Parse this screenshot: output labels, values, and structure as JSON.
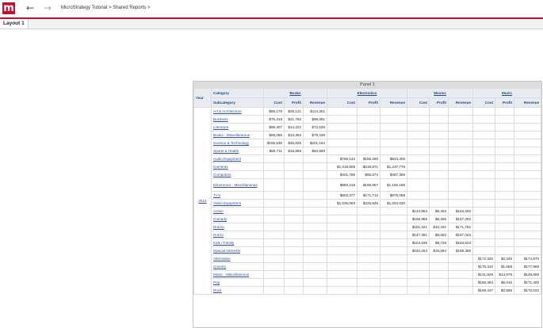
{
  "header": {
    "logo_letter": "m",
    "breadcrumb": [
      "MicroStrategy Tutorial",
      "Shared Reports"
    ],
    "breadcrumb_sep": ">",
    "brand_color": "#c8102e"
  },
  "tabs": [
    "Layout 1"
  ],
  "panel": {
    "title": "Panel 1",
    "year_header": "Year",
    "category_header": "Category",
    "subcategory_header": "Subcategory",
    "categories": [
      "Books",
      "Electronics",
      "Movies",
      "Music"
    ],
    "metrics": [
      "Cost",
      "Profit",
      "Revenue"
    ],
    "year": "2014",
    "rows": [
      {
        "sub": "Art & Architecture",
        "vals": [
          "$88,179",
          "$26,121",
          "$114,301",
          "",
          "",
          "",
          "",
          "",
          "",
          "",
          "",
          ""
        ]
      },
      {
        "sub": "Business",
        "vals": [
          "$76,319",
          "$21,762",
          "$98,081",
          "",
          "",
          "",
          "",
          "",
          "",
          "",
          "",
          ""
        ]
      },
      {
        "sub": "Literature",
        "vals": [
          "$58,407",
          "$14,222",
          "$72,629",
          "",
          "",
          "",
          "",
          "",
          "",
          "",
          "",
          ""
        ]
      },
      {
        "sub": "Books - Miscellaneous",
        "vals": [
          "$66,085",
          "$13,353",
          "$79,438",
          "",
          "",
          "",
          "",
          "",
          "",
          "",
          "",
          ""
        ]
      },
      {
        "sub": "Science & Technology",
        "vals": [
          "$155,538",
          "$45,625",
          "$201,164",
          "",
          "",
          "",
          "",
          "",
          "",
          "",
          "",
          ""
        ]
      },
      {
        "sub": "Sports & Health",
        "vals": [
          "$65,711",
          "$18,869",
          "$84,580",
          "",
          "",
          "",
          "",
          "",
          "",
          "",
          "",
          ""
        ]
      },
      {
        "sub": "Audio Equipment",
        "vals": [
          "",
          "",
          "",
          "$768,144",
          "$155,260",
          "$923,405",
          "",
          "",
          "",
          "",
          "",
          ""
        ]
      },
      {
        "sub": "Cameras",
        "vals": [
          "",
          "",
          "",
          "$1,018,905",
          "$218,871",
          "$1,237,776",
          "",
          "",
          "",
          "",
          "",
          ""
        ]
      },
      {
        "sub": "Computers",
        "vals": [
          "",
          "",
          "",
          "$401,786",
          "$85,574",
          "$487,359",
          "",
          "",
          "",
          "",
          "",
          ""
        ]
      },
      {
        "sub": "Electronics - Miscellaneous",
        "tall": true,
        "vals": [
          "",
          "",
          "",
          "$950,218",
          "$199,967",
          "$1,150,185",
          "",
          "",
          "",
          "",
          "",
          ""
        ]
      },
      {
        "sub": "TV's",
        "vals": [
          "",
          "",
          "",
          "$803,377",
          "$171,712",
          "$975,088",
          "",
          "",
          "",
          "",
          "",
          ""
        ]
      },
      {
        "sub": "Video Equipment",
        "vals": [
          "",
          "",
          "",
          "$1,028,083",
          "$225,946",
          "$1,254,030",
          "",
          "",
          "",
          "",
          "",
          ""
        ]
      },
      {
        "sub": "Action",
        "vals": [
          "",
          "",
          "",
          "",
          "",
          "",
          "$143,853",
          "$9,403",
          "$153,256",
          "",
          "",
          ""
        ]
      },
      {
        "sub": "Comedy",
        "vals": [
          "",
          "",
          "",
          "",
          "",
          "",
          "$158,956",
          "$8,306",
          "$167,262",
          "",
          "",
          ""
        ]
      },
      {
        "sub": "Drama",
        "vals": [
          "",
          "",
          "",
          "",
          "",
          "",
          "$161,321",
          "$10,431",
          "$171,752",
          "",
          "",
          ""
        ]
      },
      {
        "sub": "Horror",
        "vals": [
          "",
          "",
          "",
          "",
          "",
          "",
          "$147,361",
          "$9,682",
          "$157,043",
          "",
          "",
          ""
        ]
      },
      {
        "sub": "Kids / Family",
        "vals": [
          "",
          "",
          "",
          "",
          "",
          "",
          "$154,195",
          "$9,728",
          "$163,923",
          "",
          "",
          ""
        ]
      },
      {
        "sub": "Special Interests",
        "vals": [
          "",
          "",
          "",
          "",
          "",
          "",
          "$184,264",
          "$15,094",
          "$199,358",
          "",
          "",
          ""
        ]
      },
      {
        "sub": "Alternative",
        "vals": [
          "",
          "",
          "",
          "",
          "",
          "",
          "",
          "",
          "",
          "$172,325",
          "$2,345",
          "$174,670"
        ]
      },
      {
        "sub": "Country",
        "vals": [
          "",
          "",
          "",
          "",
          "",
          "",
          "",
          "",
          "",
          "$176,310",
          "$1,658",
          "$177,968"
        ]
      },
      {
        "sub": "Music - Miscellaneous",
        "vals": [
          "",
          "",
          "",
          "",
          "",
          "",
          "",
          "",
          "",
          "$131,929",
          "$14,978",
          "$146,906"
        ]
      },
      {
        "sub": "Pop",
        "vals": [
          "",
          "",
          "",
          "",
          "",
          "",
          "",
          "",
          "",
          "$166,384",
          "$5,016",
          "$171,400"
        ]
      },
      {
        "sub": "Rock",
        "vals": [
          "",
          "",
          "",
          "",
          "",
          "",
          "",
          "",
          "",
          "$169,437",
          "$2,595",
          "$172,032"
        ]
      }
    ]
  }
}
